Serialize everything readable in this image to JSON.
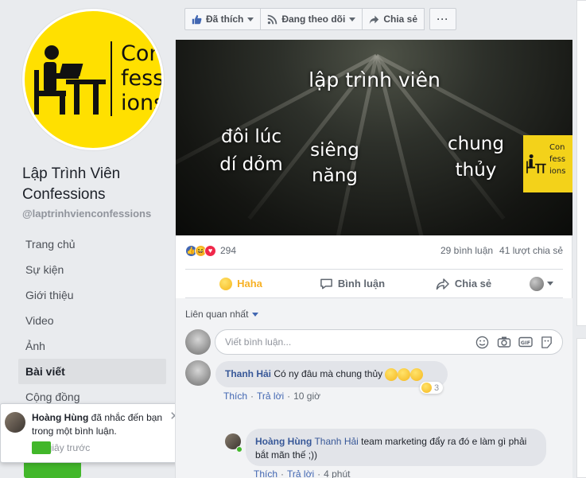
{
  "page": {
    "name": "Lập Trình Viên Confessions",
    "handle": "@laptrinhvienconfessions",
    "logo_text": [
      "Con",
      "fess",
      "ions"
    ]
  },
  "nav": {
    "items": [
      {
        "label": "Trang chủ",
        "active": false
      },
      {
        "label": "Sự kiện",
        "active": false
      },
      {
        "label": "Giới thiệu",
        "active": false
      },
      {
        "label": "Video",
        "active": false
      },
      {
        "label": "Ảnh",
        "active": false
      },
      {
        "label": "Bài viết",
        "active": true
      },
      {
        "label": "Cộng đồng",
        "active": false
      }
    ]
  },
  "topbar": {
    "liked_label": "Đã thích",
    "following_label": "Đang theo dõi",
    "share_label": "Chia sẻ",
    "more_label": "···"
  },
  "post": {
    "image": {
      "title": "lập trình viên",
      "left_text": [
        "đôi lúc",
        "dí dỏm"
      ],
      "center_text": [
        "siêng",
        "năng"
      ],
      "right_text": [
        "chung",
        "thủy"
      ],
      "badge_text": [
        "Con",
        "fess",
        "ions"
      ]
    },
    "reactions_count": "294",
    "comments_count": "29 bình luận",
    "shares_count": "41 lượt chia sẻ",
    "actions": {
      "haha": "Haha",
      "comment": "Bình luận",
      "share": "Chia sẻ"
    }
  },
  "comments": {
    "sort_label": "Liên quan nhất",
    "input_placeholder": "Viết bình luận...",
    "items": [
      {
        "author": "Thanh Hải",
        "text": "Có ny đâu mà chung thủy",
        "like": "Thích",
        "reply": "Trả lời",
        "time": "10 giờ",
        "reaction_count": "3"
      },
      {
        "author": "Hoàng Hùng",
        "mention": "Thanh Hải",
        "text": "team marketing đẩy ra đó e làm gì phải bắt mãn thế ;))",
        "like": "Thích",
        "reply": "Trả lời",
        "time": "4 phút"
      }
    ]
  },
  "notification": {
    "author": "Hoàng Hùng",
    "text": "đã nhắc đến bạn trong một bình luận.",
    "time": "vài giây trước",
    "close": "✕"
  },
  "colors": {
    "facebook_blue": "#4267b2",
    "link_blue": "#385898",
    "haha_yellow": "#f7b125",
    "logo_yellow": "#ffe000",
    "online_green": "#42b72a"
  }
}
